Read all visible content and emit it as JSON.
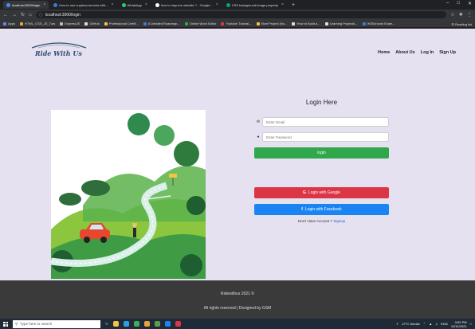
{
  "browser": {
    "tabs": [
      {
        "label": "localhost:3000/login",
        "icon": "tab-favicon-blue",
        "color": "#4c8bf5",
        "active": true
      },
      {
        "label": "How to use cryptocurrencies ethi...",
        "icon": "tab-favicon-blue",
        "color": "#3b7bd4",
        "active": false
      },
      {
        "label": "WhatsApp",
        "icon": "whatsapp-icon",
        "color": "#25d366",
        "active": false
      },
      {
        "label": "how to improve website ? - Google...",
        "icon": "google-icon",
        "color": "#ffffff",
        "active": false
      },
      {
        "label": "CSS background-image property",
        "icon": "w3schools-icon",
        "color": "#04aa6d",
        "active": false
      }
    ],
    "new_tab": "+",
    "url": "localhost:3000/login",
    "bookmarks": [
      {
        "label": "Apps",
        "color": "#7a7af0"
      },
      {
        "label": "HTML_CSS_JS_Tuts",
        "color": "#e8a33b"
      },
      {
        "label": "ExpressJS",
        "color": "#bbbbbb"
      },
      {
        "label": "GitHub",
        "color": "#dddddd"
      },
      {
        "label": "Professional Certifi...",
        "color": "#f5c242"
      },
      {
        "label": "A Detailed Roadmap...",
        "color": "#3b7bd4"
      },
      {
        "label": "Online Word Editor",
        "color": "#2fa74a"
      },
      {
        "label": "Youtube Tutorial...",
        "color": "#dc3545"
      },
      {
        "label": "Start Project (No...",
        "color": "#f5c242"
      },
      {
        "label": "How to Build a...",
        "color": "#dddddd"
      },
      {
        "label": "Learning ProjectA...",
        "color": "#dddddd"
      },
      {
        "label": "W3Schools Exam...",
        "color": "#3b7bd4"
      }
    ],
    "reading_list": "Reading list"
  },
  "navbar": {
    "logo_text": "Ride With Us",
    "links": [
      "Home",
      "About Us",
      "Log In",
      "Sign Up"
    ]
  },
  "login": {
    "title": "Login Here",
    "email_placeholder": "Enter Email",
    "password_placeholder": "Enter Password",
    "login_button": "login",
    "google_button": "Login with Google",
    "facebook_button": "Login with Facebook",
    "signup_prompt": "Don't Have Account ?",
    "signup_link": "SignUp"
  },
  "footer": {
    "line1": "Ridewithus 2021 ©",
    "line2": "All rights reserved | Designed by GSM"
  },
  "taskbar": {
    "search_placeholder": "Type here to search",
    "weather": "27°C Smoke",
    "language": "ENG",
    "time": "3:52 PM",
    "date": "12/11/2021"
  },
  "colors": {
    "page_bg": "#e6e1f0",
    "login": "#2fa74a",
    "google": "#dc3545",
    "facebook": "#1a84f3",
    "footer": "#3a3a3a"
  }
}
